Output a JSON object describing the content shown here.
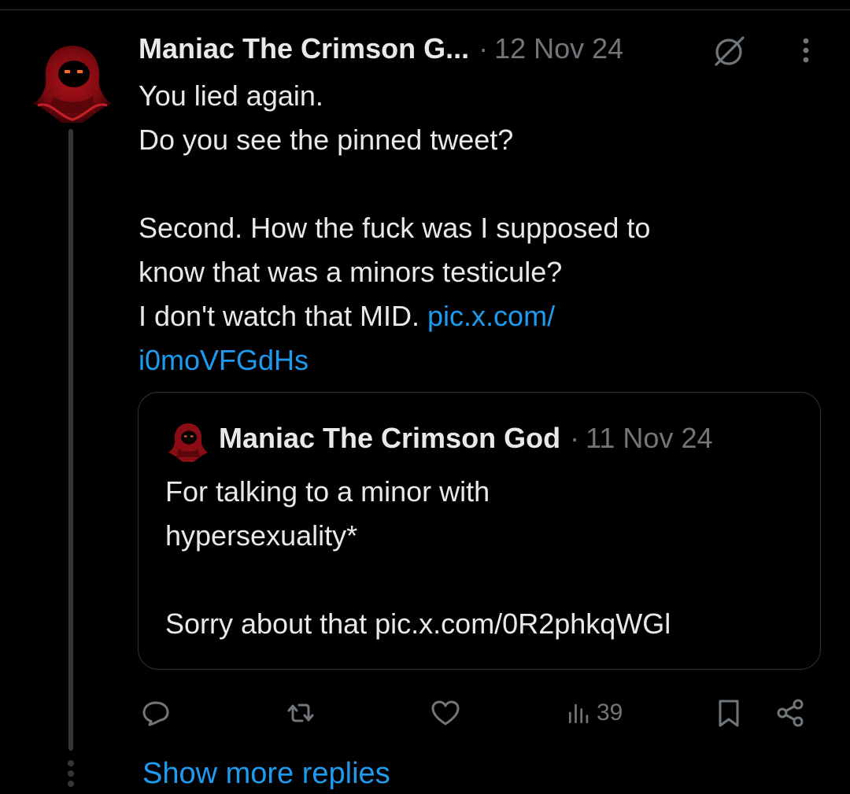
{
  "tweet": {
    "author_name": "Maniac The Crimson G...",
    "separator": "·",
    "timestamp": "12 Nov 24",
    "lines": [
      "You lied again.",
      "Do you see the pinned tweet?",
      "",
      "Second. How the fuck was I supposed to",
      "know that was a minors testicule?"
    ],
    "line6_text": "I don't watch that MID. ",
    "link_part1": "pic.x.com/",
    "link_part2": "i0moVFGdHs"
  },
  "quoted_tweet": {
    "author_name": "Maniac The Crimson God",
    "separator": "·",
    "timestamp": "11 Nov 24",
    "lines": [
      "For talking to a minor with",
      "hypersexuality*",
      "",
      "Sorry about that pic.x.com/0R2phkqWGl"
    ]
  },
  "actions": {
    "views_count": "39"
  },
  "show_more_replies": "Show more replies",
  "icons": {
    "edited": "edited-icon",
    "more": "more-options-icon",
    "reply": "reply-icon",
    "retweet": "retweet-icon",
    "like": "heart-icon",
    "views": "views-icon",
    "bookmark": "bookmark-icon",
    "share": "share-icon"
  },
  "colors": {
    "background": "#000000",
    "text": "#e7e9ea",
    "muted": "#71767b",
    "link": "#1d9bf0",
    "border": "#2f3336"
  }
}
